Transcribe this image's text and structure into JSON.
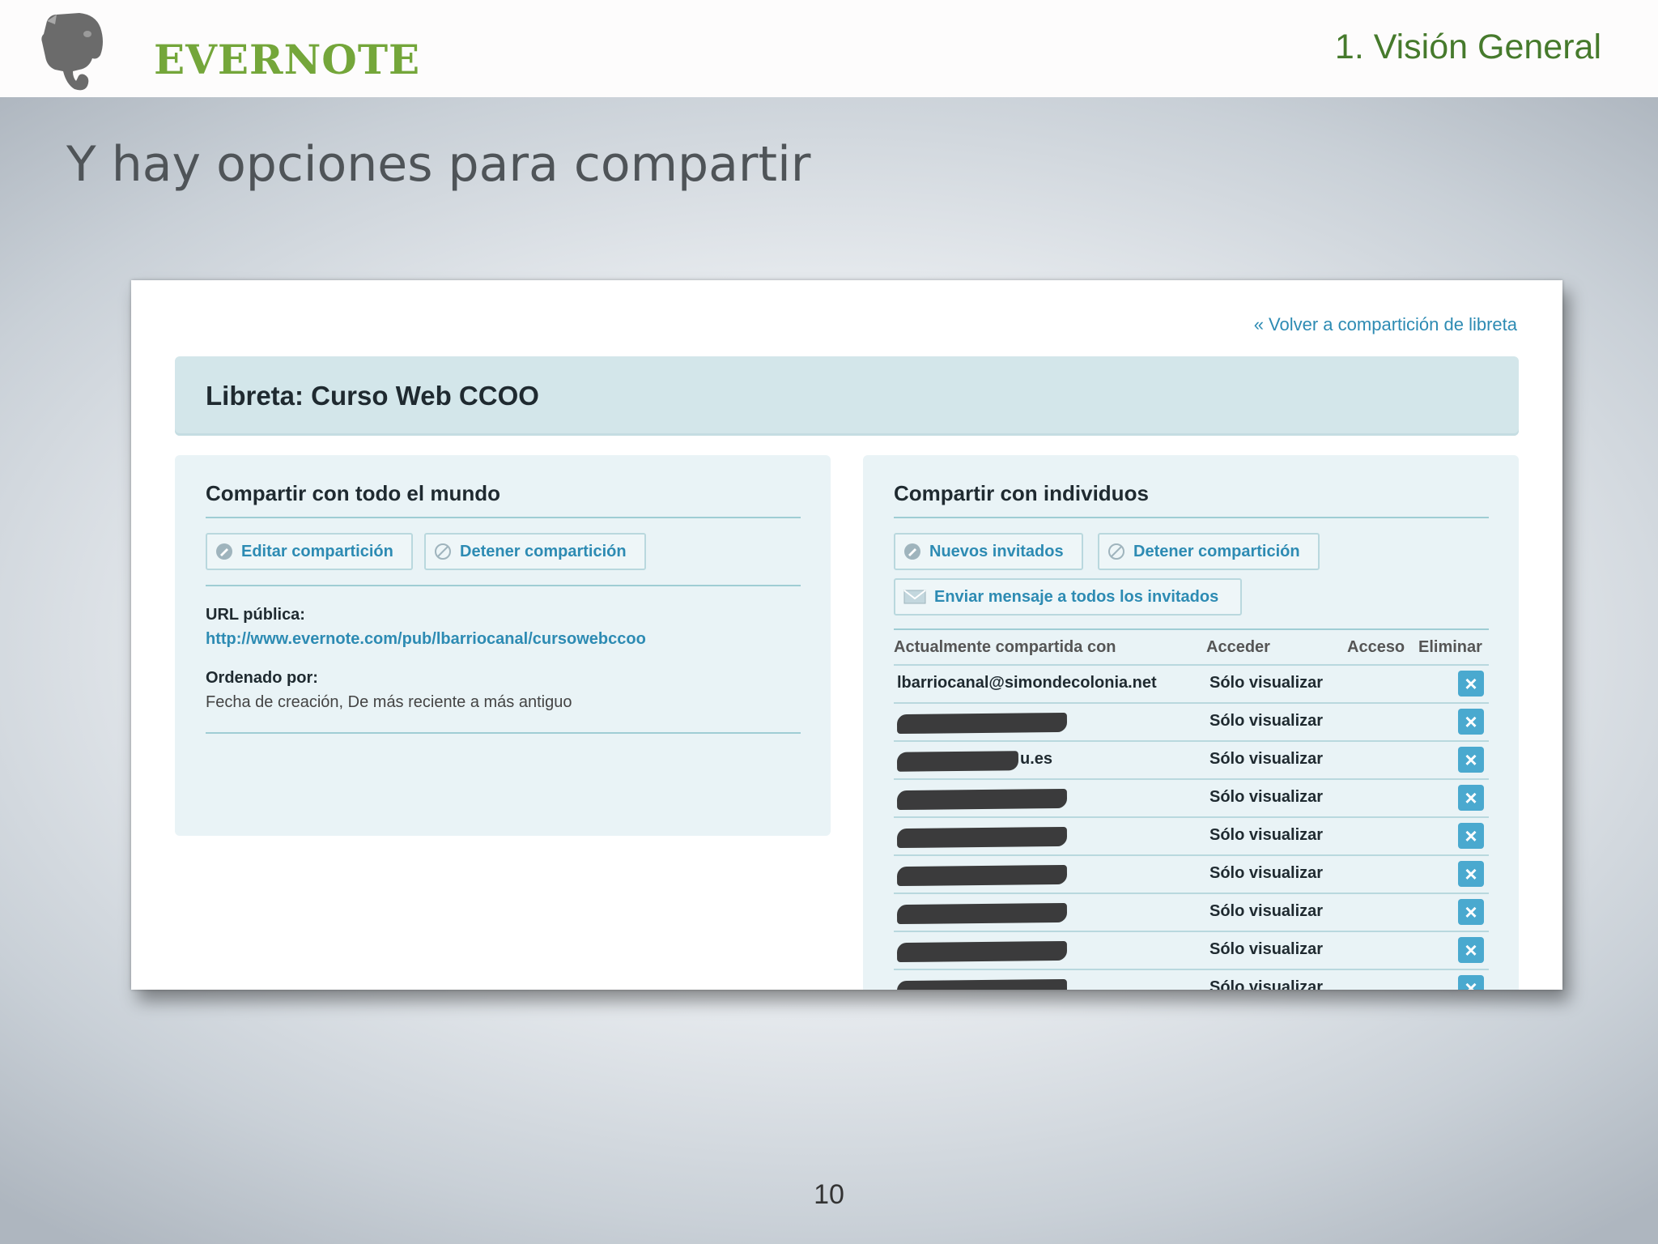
{
  "header": {
    "brand": "EVERNOTE",
    "section": "1. Visión General"
  },
  "slide": {
    "title": "Y hay opciones para compartir",
    "page_number": "10"
  },
  "screenshot": {
    "back_link": "« Volver a compartición de libreta",
    "notebook_title": "Libreta: Curso Web CCOO",
    "world": {
      "heading": "Compartir con todo el mundo",
      "edit_button": "Editar compartición",
      "stop_button": "Detener compartición",
      "url_label": "URL pública:",
      "url_value": "http://www.evernote.com/pub/lbarriocanal/cursowebccoo",
      "order_label": "Ordenado por:",
      "order_value": "Fecha de creación, De más reciente a más antiguo"
    },
    "individuals": {
      "heading": "Compartir con individuos",
      "new_button": "Nuevos invitados",
      "stop_button": "Detener compartición",
      "message_button": "Enviar mensaje a todos los invitados",
      "columns": [
        "Actualmente compartida con",
        "Acceder",
        "Acceso",
        "Eliminar"
      ],
      "rows": [
        {
          "email": "lbarriocanal@simondecolonia.net",
          "access": "Sólo visualizar"
        },
        {
          "email": "",
          "access": "Sólo visualizar"
        },
        {
          "email": "u.es",
          "access": "Sólo visualizar"
        },
        {
          "email": "",
          "access": "Sólo visualizar"
        },
        {
          "email": "",
          "access": "Sólo visualizar"
        },
        {
          "email": "",
          "access": "Sólo visualizar"
        },
        {
          "email": "",
          "access": "Sólo visualizar"
        },
        {
          "email": "",
          "access": "Sólo visualizar"
        },
        {
          "email": "",
          "access": "Sólo visualizar"
        }
      ],
      "delete_symbol": "×"
    }
  }
}
